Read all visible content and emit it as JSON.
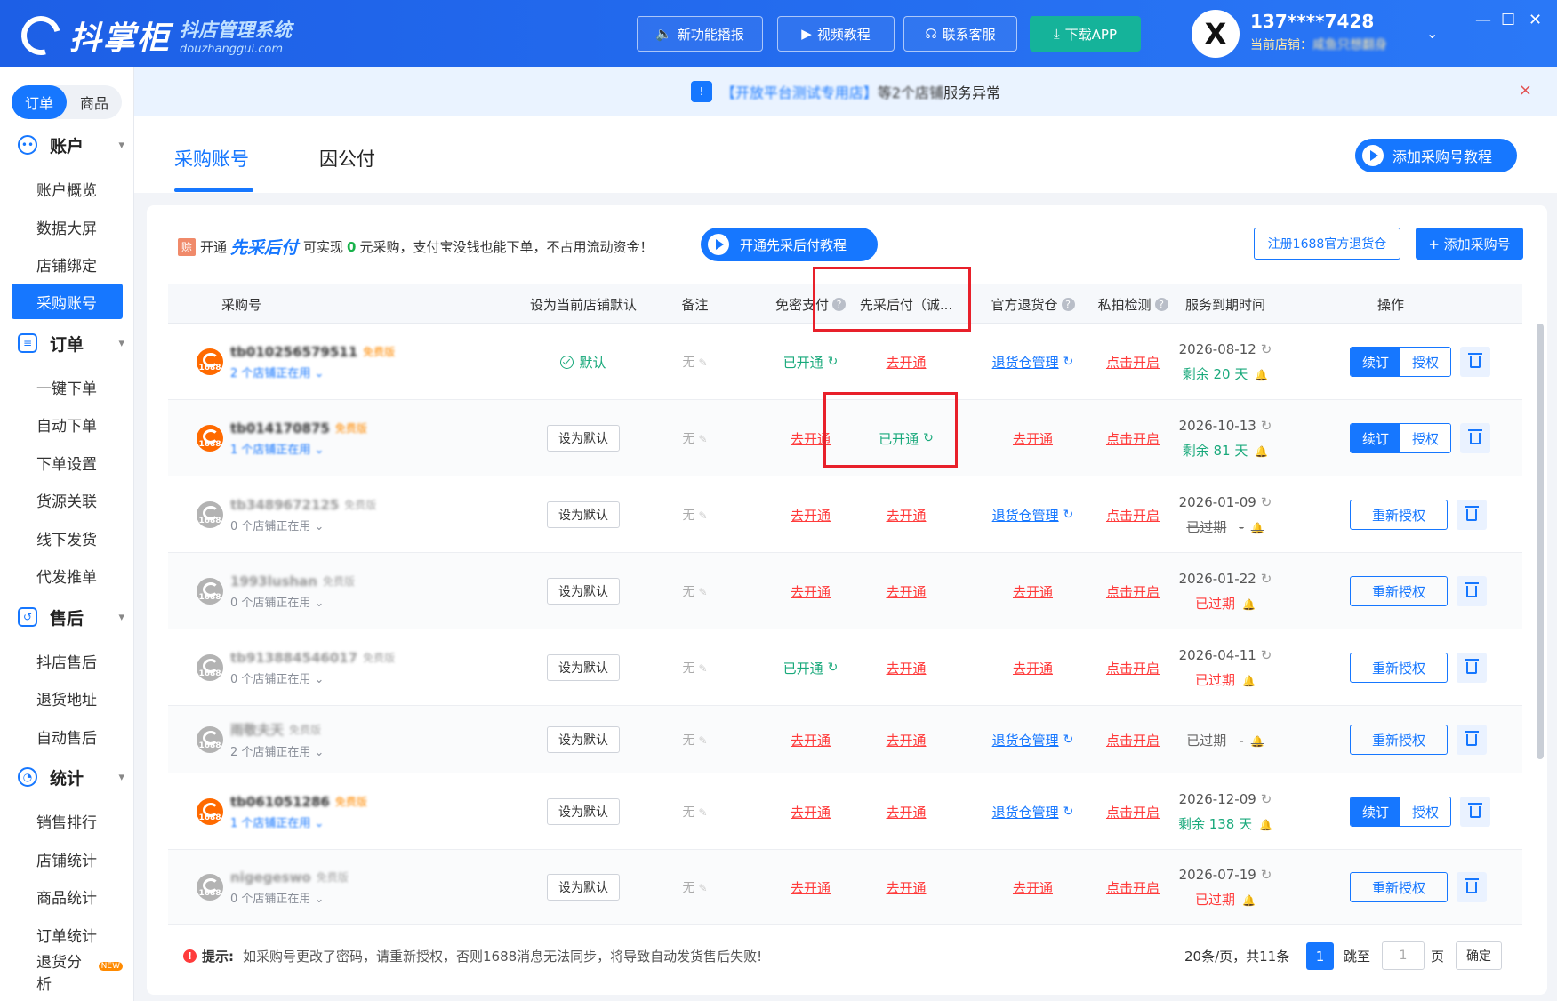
{
  "header": {
    "logo_name": "抖掌柜",
    "logo_tagline": "抖店管理系统",
    "logo_domain": "douzhanggui.com",
    "buttons": [
      "新功能播报",
      "视频教程",
      "联系客服",
      "下载APP"
    ],
    "avatar_letter": "X",
    "user_phone": "137****7428",
    "current_store_label": "当前店铺：",
    "current_store_value": "咸鱼只想翻身"
  },
  "sidebar": {
    "seg": [
      "订单",
      "商品"
    ],
    "groups": [
      {
        "label": "账户",
        "items": [
          "账户概览",
          "数据大屏",
          "店铺绑定",
          "采购账号"
        ]
      },
      {
        "label": "订单",
        "items": [
          "一键下单",
          "自动下单",
          "下单设置",
          "货源关联",
          "线下发货",
          "代发推单"
        ]
      },
      {
        "label": "售后",
        "items": [
          "抖店售后",
          "退货地址",
          "自动售后"
        ]
      },
      {
        "label": "统计",
        "items": [
          "销售排行",
          "店铺统计",
          "商品统计",
          "订单统计",
          "退货分析"
        ]
      }
    ],
    "active_item": "采购账号",
    "new_badge": "NEW"
  },
  "notice": {
    "shop": "【开放平台测试专用店】",
    "mid": "等2个店铺",
    "tail": "服务异常",
    "close": "×"
  },
  "tabs": [
    "采购账号",
    "因公付"
  ],
  "tutorial_button": "添加采购号教程",
  "promo": {
    "tag": "赊",
    "prefix": "开通",
    "brand": "先采后付",
    "text1": "可实现",
    "zero": "0",
    "text2": "元采购，支付宝没钱也能下单，不占用流动资金！",
    "button": "开通先采后付教程"
  },
  "actions": {
    "register": "注册1688官方退货仓",
    "add": "+ 添加采购号"
  },
  "table": {
    "headers": [
      "采购号",
      "设为当前店铺默认",
      "备注",
      "免密支付",
      "先采后付（诚...",
      "官方退货仓",
      "私拍检测",
      "服务到期时间",
      "操作"
    ],
    "rows": [
      {
        "name": "tb010256579511",
        "ver": "免费版",
        "sub": "2 个店铺正在用",
        "def": "默认",
        "note": "无",
        "mm": "已开通",
        "xc": "去开通",
        "th": "退货仓管理",
        "sp": "点击开启",
        "date": "2026-08-12",
        "status": "剩余 20 天",
        "ops": [
          "续订",
          "授权"
        ]
      },
      {
        "name": "tb014170875",
        "ver": "免费版",
        "sub": "1 个店铺正在用",
        "def": "设为默认",
        "note": "无",
        "mm": "去开通",
        "xc": "已开通",
        "th": "去开通",
        "sp": "点击开启",
        "date": "2026-10-13",
        "status": "剩余 81 天",
        "ops": [
          "续订",
          "授权"
        ]
      },
      {
        "name": "tb3489672125",
        "ver": "免费版",
        "sub": "0 个店铺正在用",
        "def": "设为默认",
        "note": "无",
        "mm": "去开通",
        "xc": "去开通",
        "th": "退货仓管理",
        "sp": "点击开启",
        "date": "2026-01-09",
        "status": "已过期",
        "dash": "-",
        "ops": [
          "重新授权"
        ]
      },
      {
        "name": "1993lushan",
        "ver": "免费版",
        "sub": "0 个店铺正在用",
        "def": "设为默认",
        "note": "无",
        "mm": "去开通",
        "xc": "去开通",
        "th": "去开通",
        "sp": "点击开启",
        "date": "2026-01-22",
        "status": "已过期",
        "ops": [
          "重新授权"
        ]
      },
      {
        "name": "tb913884546017",
        "ver": "免费版",
        "sub": "0 个店铺正在用",
        "def": "设为默认",
        "note": "无",
        "mm": "已开通",
        "xc": "去开通",
        "th": "去开通",
        "sp": "点击开启",
        "date": "2026-04-11",
        "status": "已过期",
        "ops": [
          "重新授权"
        ]
      },
      {
        "name": "雨敬夫天",
        "ver": "免费版",
        "sub": "2 个店铺正在用",
        "def": "设为默认",
        "note": "无",
        "mm": "去开通",
        "xc": "去开通",
        "th": "退货仓管理",
        "sp": "点击开启",
        "date": "",
        "status": "已过期",
        "dash": "-",
        "ops": [
          "重新授权"
        ]
      },
      {
        "name": "tb061051286",
        "ver": "免费版",
        "sub": "1 个店铺正在用",
        "def": "设为默认",
        "note": "无",
        "mm": "去开通",
        "xc": "去开通",
        "th": "退货仓管理",
        "sp": "点击开启",
        "date": "2026-12-09",
        "status": "剩余 138 天",
        "ops": [
          "续订",
          "授权"
        ]
      },
      {
        "name": "nigegeswo",
        "ver": "免费版",
        "sub": "0 个店铺正在用",
        "def": "设为默认",
        "note": "无",
        "mm": "去开通",
        "xc": "去开通",
        "th": "去开通",
        "sp": "点击开启",
        "date": "2026-07-19",
        "status": "已过期",
        "ops": [
          "重新授权"
        ]
      }
    ]
  },
  "footer": {
    "tip_label": "提示:",
    "tip_text": "如采购号更改了密码，请重新授权，否则1688消息无法同步，将导致自动发货售后失败!",
    "per_page": "20条/页，共11条",
    "page": "1",
    "jump": "跳至",
    "jump_value": "1",
    "page_unit": "页",
    "confirm": "确定"
  }
}
